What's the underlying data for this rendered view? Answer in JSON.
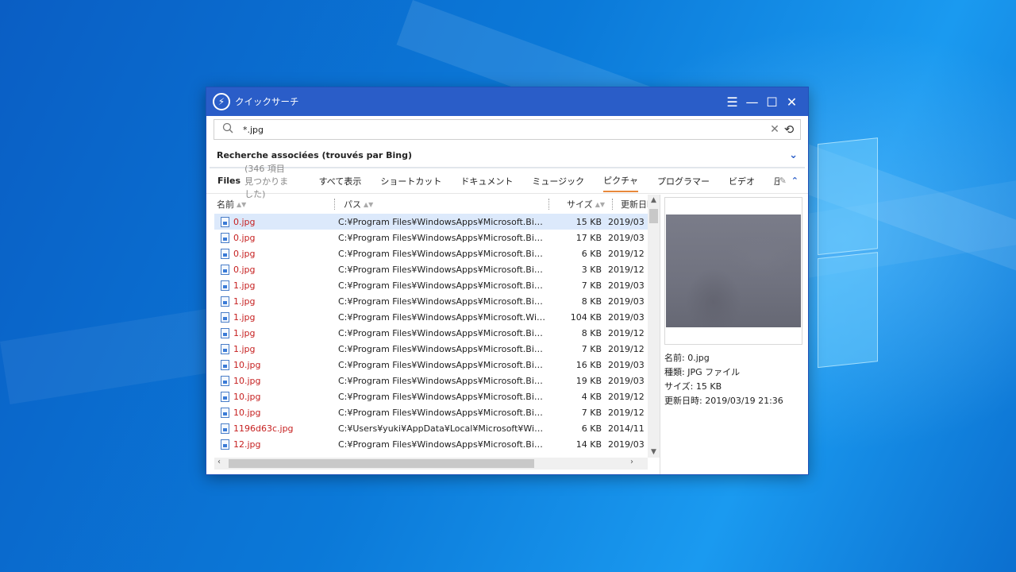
{
  "window": {
    "title": "クイックサーチ",
    "logo_glyph": "⚡"
  },
  "titlebar_buttons": {
    "menu": "☰",
    "minimize": "—",
    "maximize": "☐",
    "close": "✕"
  },
  "search": {
    "value": "*.jpg",
    "icon": "search-icon",
    "clear_glyph": "✕",
    "history_glyph": "⟲"
  },
  "related": {
    "title": "Recherche associées (trouvés par Bing)",
    "chevron": "⌄"
  },
  "tabs": {
    "files_label": "Files",
    "count_label": "(346 項目見つかりました)",
    "items": [
      "すべて表示",
      "ショートカット",
      "ドキュメント",
      "ミュージック",
      "ピクチャ",
      "プログラマー",
      "ビデオ",
      "圧縮"
    ],
    "active_index": 4,
    "edit_glyph": "✎",
    "collapse_glyph": "⌃"
  },
  "columns": {
    "name": "名前",
    "path": "パス",
    "size": "サイズ",
    "date": "更新日時"
  },
  "rows": [
    {
      "name": "0.jpg",
      "path": "C:¥Program Files¥WindowsApps¥Microsoft.BingWe...",
      "size": "15 KB",
      "date": "2019/03"
    },
    {
      "name": "0.jpg",
      "path": "C:¥Program Files¥WindowsApps¥Microsoft.BingWe...",
      "size": "17 KB",
      "date": "2019/03"
    },
    {
      "name": "0.jpg",
      "path": "C:¥Program Files¥WindowsApps¥Microsoft.BingWe...",
      "size": "6 KB",
      "date": "2019/12"
    },
    {
      "name": "0.jpg",
      "path": "C:¥Program Files¥WindowsApps¥Microsoft.BingWe...",
      "size": "3 KB",
      "date": "2019/12"
    },
    {
      "name": "1.jpg",
      "path": "C:¥Program Files¥WindowsApps¥Microsoft.BingWe...",
      "size": "7 KB",
      "date": "2019/03"
    },
    {
      "name": "1.jpg",
      "path": "C:¥Program Files¥WindowsApps¥Microsoft.BingWe...",
      "size": "8 KB",
      "date": "2019/03"
    },
    {
      "name": "1.jpg",
      "path": "C:¥Program Files¥WindowsApps¥Microsoft.Window...",
      "size": "104 KB",
      "date": "2019/03"
    },
    {
      "name": "1.jpg",
      "path": "C:¥Program Files¥WindowsApps¥Microsoft.BingWe...",
      "size": "8 KB",
      "date": "2019/12"
    },
    {
      "name": "1.jpg",
      "path": "C:¥Program Files¥WindowsApps¥Microsoft.BingWe...",
      "size": "7 KB",
      "date": "2019/12"
    },
    {
      "name": "10.jpg",
      "path": "C:¥Program Files¥WindowsApps¥Microsoft.BingWe...",
      "size": "16 KB",
      "date": "2019/03"
    },
    {
      "name": "10.jpg",
      "path": "C:¥Program Files¥WindowsApps¥Microsoft.BingWe...",
      "size": "19 KB",
      "date": "2019/03"
    },
    {
      "name": "10.jpg",
      "path": "C:¥Program Files¥WindowsApps¥Microsoft.BingWe...",
      "size": "4 KB",
      "date": "2019/12"
    },
    {
      "name": "10.jpg",
      "path": "C:¥Program Files¥WindowsApps¥Microsoft.BingWe...",
      "size": "7 KB",
      "date": "2019/12"
    },
    {
      "name": "1196d63c.jpg",
      "path": "C:¥Users¥yuki¥AppData¥Local¥Microsoft¥Windows...",
      "size": "6 KB",
      "date": "2014/11"
    },
    {
      "name": "12.jpg",
      "path": "C:¥Program Files¥WindowsApps¥Microsoft.BingWe...",
      "size": "14 KB",
      "date": "2019/03"
    }
  ],
  "selected_row": 0,
  "preview": {
    "meta": [
      "名前: 0.jpg",
      "種類: JPG ファイル",
      "サイズ: 15 KB",
      "更新日時: 2019/03/19 21:36"
    ]
  },
  "colors": {
    "titlebar": "#2a5dc8",
    "filename": "#c62020",
    "active_tab_underline": "#e8893b",
    "selected_row": "#dce9fb"
  }
}
